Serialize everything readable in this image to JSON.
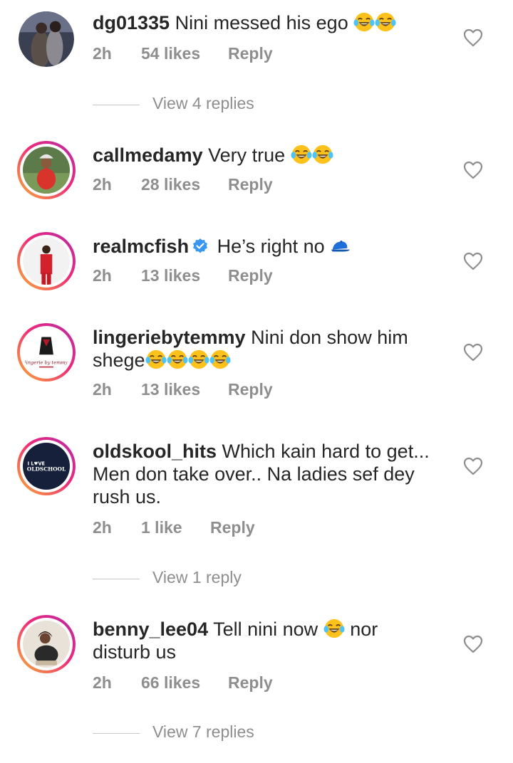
{
  "comments": [
    {
      "username": "dg01335",
      "text": "Nini messed his ego",
      "emoji_count": 2,
      "time": "2h",
      "likes": "54 likes",
      "reply": "Reply",
      "view_replies": "View 4 replies"
    },
    {
      "username": "callmedamy",
      "text": "Very true",
      "emoji_count": 2,
      "time": "2h",
      "likes": "28 likes",
      "reply": "Reply"
    },
    {
      "username": "realmcfish",
      "verified": true,
      "text": "He’s right no",
      "time": "2h",
      "likes": "13 likes",
      "reply": "Reply"
    },
    {
      "username": "lingeriebytemmy",
      "text_line1": "Nini don show him",
      "text_line2": "shege",
      "emoji_count": 4,
      "time": "2h",
      "likes": "13 likes",
      "reply": "Reply"
    },
    {
      "username": "oldskool_hits",
      "text_line1": "Which kain hard to get...",
      "text_line2": "Men don take over.. Na ladies sef dey",
      "text_line3": "rush us.",
      "time": "2h",
      "likes": "1 like",
      "reply": "Reply",
      "view_replies": "View 1 reply",
      "avatar_text_1": "I L♥VE",
      "avatar_text_2": "OLDSCHOOL"
    },
    {
      "username": "benny_lee04",
      "text_line1a": "Tell nini now",
      "text_line1b": "nor",
      "text_line2": "disturb us",
      "emoji_count": 1,
      "time": "2h",
      "likes": "66 likes",
      "reply": "Reply",
      "view_replies": "View 7 replies"
    }
  ],
  "icons": {
    "like": "heart-outline-icon",
    "verified": "verified-badge-icon",
    "emoji": "tears-of-joy-emoji",
    "cap": "blue-cap-emoji"
  },
  "colors": {
    "text": "#262626",
    "muted": "#8e8e8e",
    "verified": "#3897f0",
    "story_ring_start": "#f9b232",
    "story_ring_end": "#b62aa6"
  }
}
